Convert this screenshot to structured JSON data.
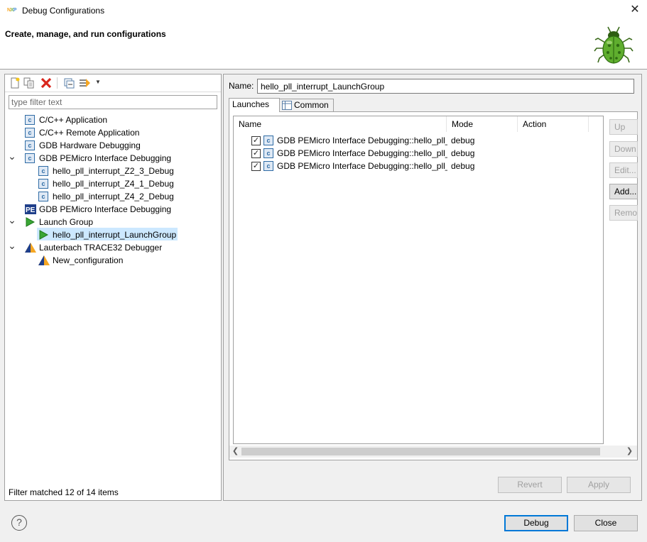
{
  "window": {
    "title": "Debug Configurations",
    "close_glyph": "✕",
    "icon_name": "nxp-logo-icon"
  },
  "banner": {
    "title": "Create, manage, and run configurations",
    "icon_name": "bug-icon"
  },
  "left_toolbar": {
    "icons": [
      "new-configuration-icon",
      "duplicate-icon",
      "delete-icon",
      "collapse-all-icon",
      "filter-icon",
      "dropdown-arrow-icon"
    ]
  },
  "filter": {
    "placeholder": "type filter text",
    "status": "Filter matched 12 of 14 items"
  },
  "tree": {
    "items": [
      {
        "label": "C/C++ Application",
        "icon": "c-app-icon",
        "level": 0,
        "expanded": null
      },
      {
        "label": "C/C++ Remote Application",
        "icon": "c-app-icon",
        "level": 0,
        "expanded": null
      },
      {
        "label": "GDB Hardware Debugging",
        "icon": "c-app-icon",
        "level": 0,
        "expanded": null
      },
      {
        "label": "GDB PEMicro Interface Debugging",
        "icon": "c-app-icon",
        "level": 0,
        "expanded": true
      },
      {
        "label": "hello_pll_interrupt_Z2_3_Debug",
        "icon": "c-app-icon",
        "level": 1,
        "expanded": null
      },
      {
        "label": "hello_pll_interrupt_Z4_1_Debug",
        "icon": "c-app-icon",
        "level": 1,
        "expanded": null
      },
      {
        "label": "hello_pll_interrupt_Z4_2_Debug",
        "icon": "c-app-icon",
        "level": 1,
        "expanded": null
      },
      {
        "label": "GDB PEMicro Interface Debugging",
        "icon": "pemicro-icon",
        "level": 0,
        "expanded": null
      },
      {
        "label": "Launch Group",
        "icon": "launch-group-icon",
        "level": 0,
        "expanded": true
      },
      {
        "label": "hello_pll_interrupt_LaunchGroup",
        "icon": "launch-group-icon",
        "level": 1,
        "expanded": null,
        "selected": true
      },
      {
        "label": "Lauterbach TRACE32 Debugger",
        "icon": "trace32-icon",
        "level": 0,
        "expanded": true
      },
      {
        "label": "New_configuration",
        "icon": "trace32-icon",
        "level": 1,
        "expanded": null
      }
    ]
  },
  "right": {
    "name_label": "Name:",
    "name_value": "hello_pll_interrupt_LaunchGroup",
    "tabs": [
      {
        "label": "Launches",
        "active": true
      },
      {
        "label": "Common",
        "active": false
      }
    ],
    "table": {
      "columns": [
        "Name",
        "Mode",
        "Action"
      ],
      "rows": [
        {
          "checked": true,
          "name": "GDB PEMicro Interface Debugging::hello_pll_i",
          "mode": "debug",
          "action": ""
        },
        {
          "checked": true,
          "name": "GDB PEMicro Interface Debugging::hello_pll_i",
          "mode": "debug",
          "action": ""
        },
        {
          "checked": true,
          "name": "GDB PEMicro Interface Debugging::hello_pll_i",
          "mode": "debug",
          "action": ""
        }
      ]
    },
    "side_buttons": [
      {
        "label": "Up",
        "enabled": false
      },
      {
        "label": "Down",
        "enabled": false
      },
      {
        "label": "Edit...",
        "enabled": false
      },
      {
        "label": "Add...",
        "enabled": true
      },
      {
        "label": "Remove",
        "enabled": false
      }
    ],
    "revert_label": "Revert",
    "apply_label": "Apply"
  },
  "footer": {
    "help_glyph": "?",
    "debug_label": "Debug",
    "close_label": "Close"
  },
  "colors": {
    "selection": "#cce8ff",
    "default_button_border": "#0078d7",
    "delete_red": "#d9261c",
    "launch_green": "#3aa635"
  }
}
